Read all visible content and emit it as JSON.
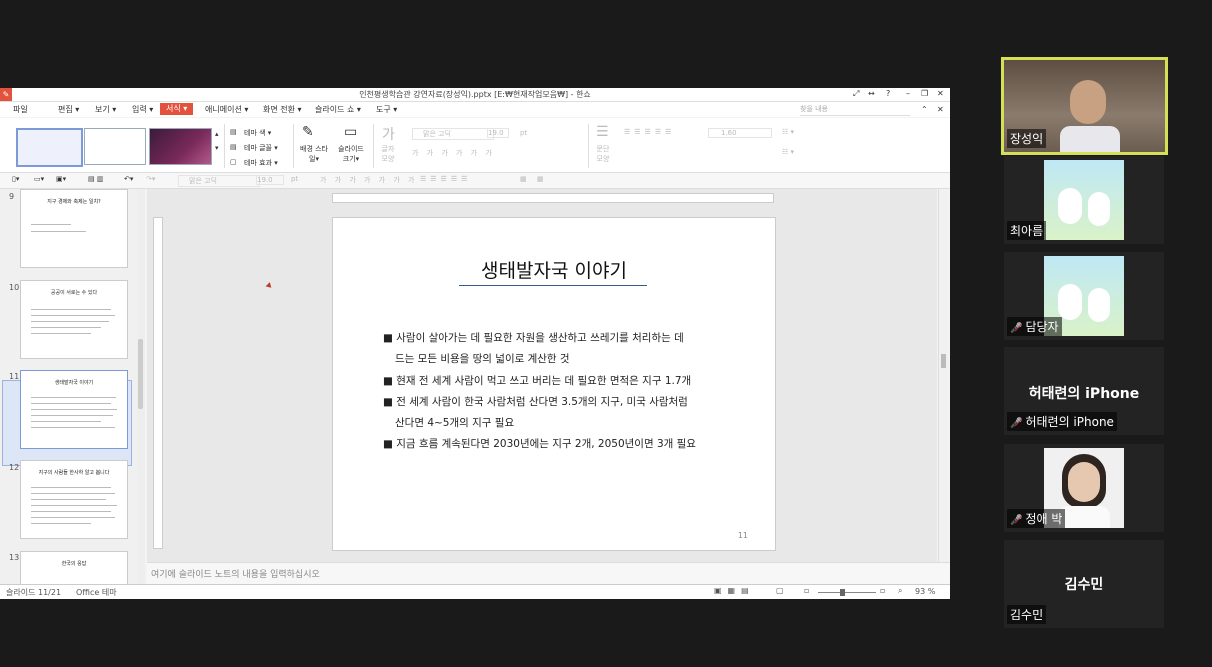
{
  "window": {
    "title": "인천평생학습관 강연자료(장성익).pptx [E:₩현재작업모음₩] - 한쇼",
    "controls": [
      "⤢",
      "↔",
      "?",
      "–",
      "❐",
      "✕"
    ]
  },
  "menu": {
    "items": [
      "파일",
      "편집 ▾",
      "보기 ▾",
      "입력 ▾",
      "서식 ▾",
      "애니메이션 ▾",
      "화면 전환 ▾",
      "슬라이드 쇼 ▾",
      "도구 ▾"
    ],
    "active": "서식 ▾",
    "search_placeholder": "찾을 내용"
  },
  "ribbon": {
    "theme_color": "테마 색 ▾",
    "theme_font": "테마 글꼴 ▾",
    "theme_effect": "테마 효과 ▾",
    "background_style": "배경 스타일▾",
    "slide_size": "슬라이드 크기▾",
    "char_shape": "글자 모양",
    "font_name": "맑은 고딕",
    "font_size": "19.0",
    "font_unit": "pt",
    "para_shape": "문단 모양",
    "line_spacing": "1.60"
  },
  "quickbar": {
    "font_name": "맑은 고딕",
    "font_size": "19.0",
    "font_unit": "pt"
  },
  "slides": [
    {
      "num": "9",
      "title": "지구 경제와 축제는 일치?"
    },
    {
      "num": "10",
      "title": "공공이 서로는 수 있다"
    },
    {
      "num": "11",
      "title": "생태발자국 이야기"
    },
    {
      "num": "12",
      "title": "지구의 사람들 한사하 알고 봅니다"
    },
    {
      "num": "13",
      "title": "한국의 응답"
    }
  ],
  "current_slide": {
    "title": "생태발자국 이야기",
    "bullets": [
      {
        "line1": "사람이 살아가는 데 필요한 자원을 생산하고 쓰레기를 처리하는 데",
        "line2": "드는 모든 비용을 땅의 넓이로 계산한 것"
      },
      {
        "line1": "현재 전 세계 사람이 먹고 쓰고 버리는 데 필요한 면적은 지구 1.7개",
        "line2": ""
      },
      {
        "line1": "전 세계 사람이 한국 사람처럼 산다면 3.5개의 지구, 미국 사람처럼",
        "line2": "산다면 4~5개의 지구 필요"
      },
      {
        "line1": "지금 흐름 계속된다면 2030년에는 지구 2개, 2050년이면 3개 필요",
        "line2": ""
      }
    ],
    "number": "11"
  },
  "notes_placeholder": "여기에 슬라이드 노트의 내용을 입력하십시오",
  "status": {
    "slide_position": "슬라이드 11/21",
    "theme": "Office 테마",
    "zoom": "93 %"
  },
  "participants": [
    {
      "name": "장성익",
      "muted": false,
      "type": "video"
    },
    {
      "name": "최아름",
      "muted": false,
      "type": "image"
    },
    {
      "name": "담당자",
      "muted": true,
      "type": "image"
    },
    {
      "name": "허태련의 iPhone",
      "muted": true,
      "type": "text",
      "display": "허태련의 iPhone"
    },
    {
      "name": "정애 박",
      "muted": true,
      "type": "photo"
    },
    {
      "name": "김수민",
      "muted": false,
      "type": "text",
      "display": "김수민"
    }
  ],
  "colors": {
    "accent": "#e2523c",
    "active_speaker_border": "#d4e157",
    "title_underline": "#3a5a8a"
  }
}
